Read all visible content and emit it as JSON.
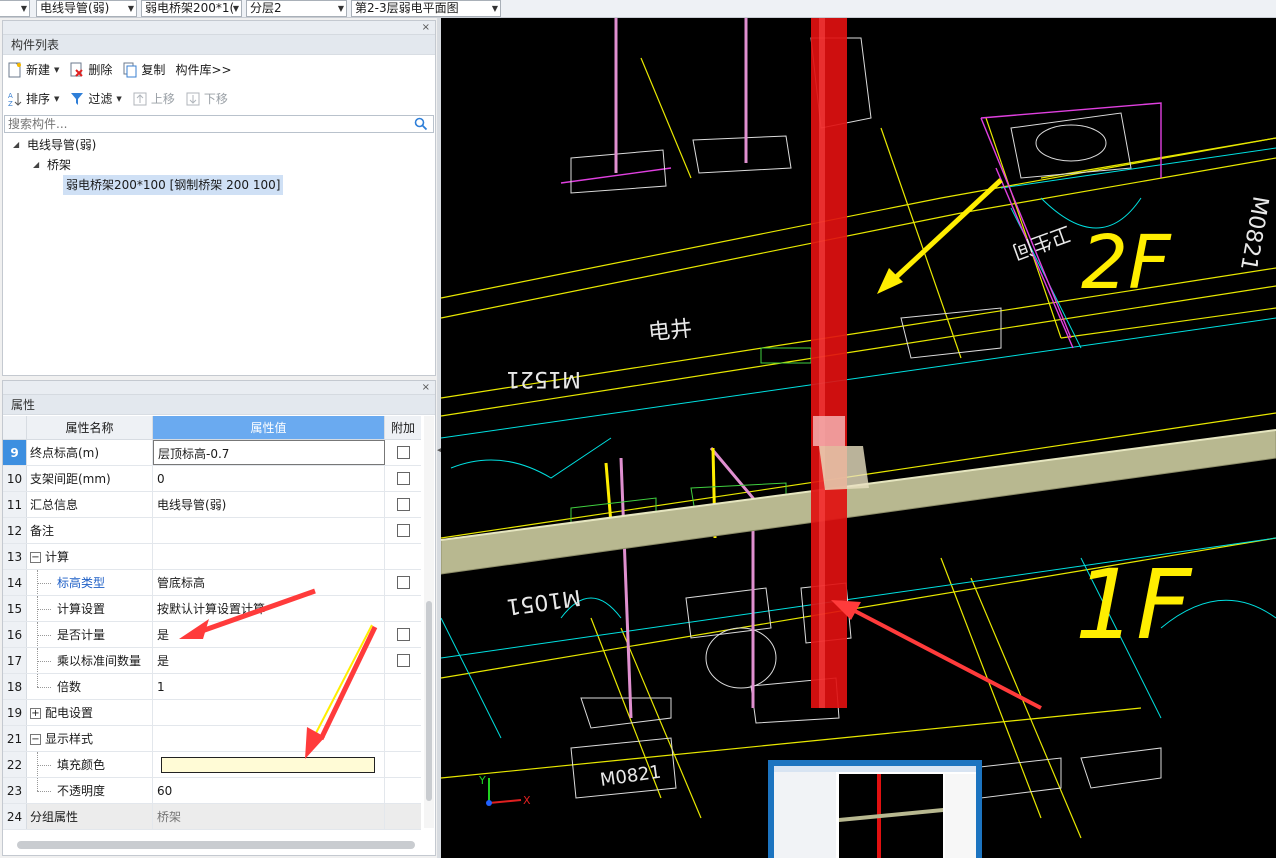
{
  "topbar": {
    "dropdowns": [
      "电线导管(弱)",
      "弱电桥架200*1(",
      "分层2",
      "第2-3层弱电平面图"
    ]
  },
  "component_panel": {
    "title": "构件列表",
    "close_symbol": "×",
    "toolbar1": {
      "new": "新建",
      "delete": "删除",
      "copy": "复制",
      "library": "构件库>>"
    },
    "toolbar2": {
      "sort": "排序",
      "filter": "过滤",
      "move_up": "上移",
      "move_down": "下移"
    },
    "search_placeholder": "搜索构件...",
    "tree": {
      "root": "电线导管(弱)",
      "child": "桥架",
      "leaf": "弱电桥架200*100 [钢制桥架 200 100]"
    }
  },
  "property_panel": {
    "title": "属性",
    "close_symbol": "×",
    "headers": {
      "name": "属性名称",
      "value": "属性值",
      "extra": "附加"
    },
    "rows": [
      {
        "num": "9",
        "name": "终点标高(m)",
        "value": "层顶标高-0.7"
      },
      {
        "num": "10",
        "name": "支架间距(mm)",
        "value": "0"
      },
      {
        "num": "11",
        "name": "汇总信息",
        "value": "电线导管(弱)"
      },
      {
        "num": "12",
        "name": "备注",
        "value": ""
      },
      {
        "num": "13",
        "name": "计算",
        "value": ""
      },
      {
        "num": "14",
        "name": "标高类型",
        "value": "管底标高"
      },
      {
        "num": "15",
        "name": "计算设置",
        "value": "按默认计算设置计算"
      },
      {
        "num": "16",
        "name": "是否计量",
        "value": "是"
      },
      {
        "num": "17",
        "name": "乘以标准间数量",
        "value": "是"
      },
      {
        "num": "18",
        "name": "倍数",
        "value": "1"
      },
      {
        "num": "19",
        "name": "配电设置",
        "value": ""
      },
      {
        "num": "21",
        "name": "显示样式",
        "value": ""
      },
      {
        "num": "22",
        "name": "填充颜色",
        "value": ""
      },
      {
        "num": "23",
        "name": "不透明度",
        "value": "60"
      },
      {
        "num": "24",
        "name": "分组属性",
        "value": "桥架"
      }
    ],
    "expander_minus": "−",
    "expander_plus": "+"
  },
  "viewport": {
    "cad_labels": {
      "electric_well": "电井",
      "toilet": "卫生间",
      "floor2": "2F",
      "floor1": "1F",
      "mirror_w1": "M1521",
      "mirror_w2": "M1051",
      "mirror_w3": "M0821",
      "mirror_w4": "M0821",
      "axis_x": "X",
      "axis_y": "Y"
    },
    "colors": {
      "riser": "#e01010",
      "tray": "#b8b890",
      "annotation_yellow": "#ffee00",
      "annotation_red": "#ff3b3b"
    }
  }
}
